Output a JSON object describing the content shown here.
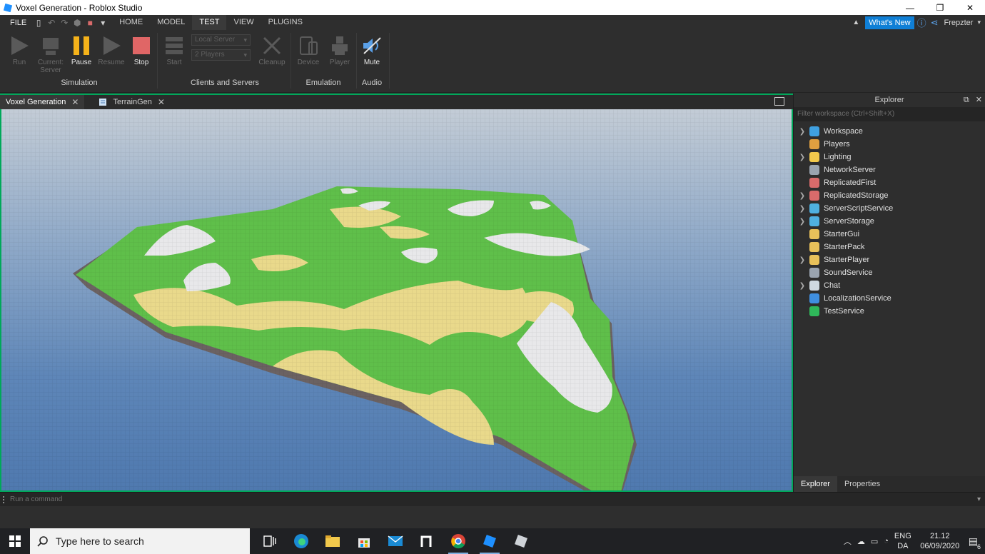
{
  "window": {
    "title": "Voxel Generation - Roblox Studio",
    "minimize": "—",
    "restore": "❐",
    "close": "✕"
  },
  "menu": {
    "file": "FILE",
    "tabs": [
      "HOME",
      "MODEL",
      "TEST",
      "VIEW",
      "PLUGINS"
    ],
    "active_tab": "TEST",
    "whats_new": "What's New",
    "user": "Frepzter"
  },
  "ribbon": {
    "run": "Run",
    "current_server": "Current:\nServer",
    "current": "Current:",
    "server": "Server",
    "pause": "Pause",
    "resume": "Resume",
    "stop": "Stop",
    "start": "Start",
    "local_server": "Local Server",
    "players_count": "2 Players",
    "cleanup": "Cleanup",
    "device": "Device",
    "player": "Player",
    "mute": "Mute",
    "groups": {
      "simulation": "Simulation",
      "clients_servers": "Clients and Servers",
      "emulation": "Emulation",
      "audio": "Audio"
    },
    "colors": {
      "pause": "#f5b21a",
      "stop": "#e06666",
      "mute": "#5aa0e8"
    }
  },
  "editor_tabs": [
    {
      "label": "Voxel Generation",
      "close": "✕"
    },
    {
      "label": "TerrainGen",
      "close": "✕"
    }
  ],
  "explorer": {
    "title": "Explorer",
    "filter_placeholder": "Filter workspace (Ctrl+Shift+X)",
    "items": [
      {
        "label": "Workspace",
        "expandable": true,
        "color": "#3fa0e0"
      },
      {
        "label": "Players",
        "expandable": false,
        "color": "#e0a040"
      },
      {
        "label": "Lighting",
        "expandable": true,
        "color": "#f2c94c"
      },
      {
        "label": "NetworkServer",
        "expandable": false,
        "color": "#9aa4b0"
      },
      {
        "label": "ReplicatedFirst",
        "expandable": false,
        "color": "#d96b6b"
      },
      {
        "label": "ReplicatedStorage",
        "expandable": true,
        "color": "#d96b6b"
      },
      {
        "label": "ServerScriptService",
        "expandable": true,
        "color": "#4fb0e0"
      },
      {
        "label": "ServerStorage",
        "expandable": true,
        "color": "#4fb0e0"
      },
      {
        "label": "StarterGui",
        "expandable": false,
        "color": "#e8c15a"
      },
      {
        "label": "StarterPack",
        "expandable": false,
        "color": "#e8c15a"
      },
      {
        "label": "StarterPlayer",
        "expandable": true,
        "color": "#e8c15a"
      },
      {
        "label": "SoundService",
        "expandable": false,
        "color": "#9aa4b0"
      },
      {
        "label": "Chat",
        "expandable": true,
        "color": "#cfd8e0"
      },
      {
        "label": "LocalizationService",
        "expandable": false,
        "color": "#3f8fe0"
      },
      {
        "label": "TestService",
        "expandable": false,
        "color": "#2fb85a"
      }
    ],
    "bottom_tabs": [
      "Explorer",
      "Properties"
    ]
  },
  "command_bar": {
    "placeholder": "Run a command"
  },
  "taskbar": {
    "search_placeholder": "Type here to search",
    "lang_top": "ENG",
    "lang_bottom": "DA",
    "time": "21.12",
    "date": "06/09/2020",
    "notifications": "6"
  },
  "terrain_colors": {
    "grass": "#5fbf4a",
    "sand": "#e9d98b",
    "snow": "#e8e8ea",
    "cliff": "#6b6262"
  }
}
